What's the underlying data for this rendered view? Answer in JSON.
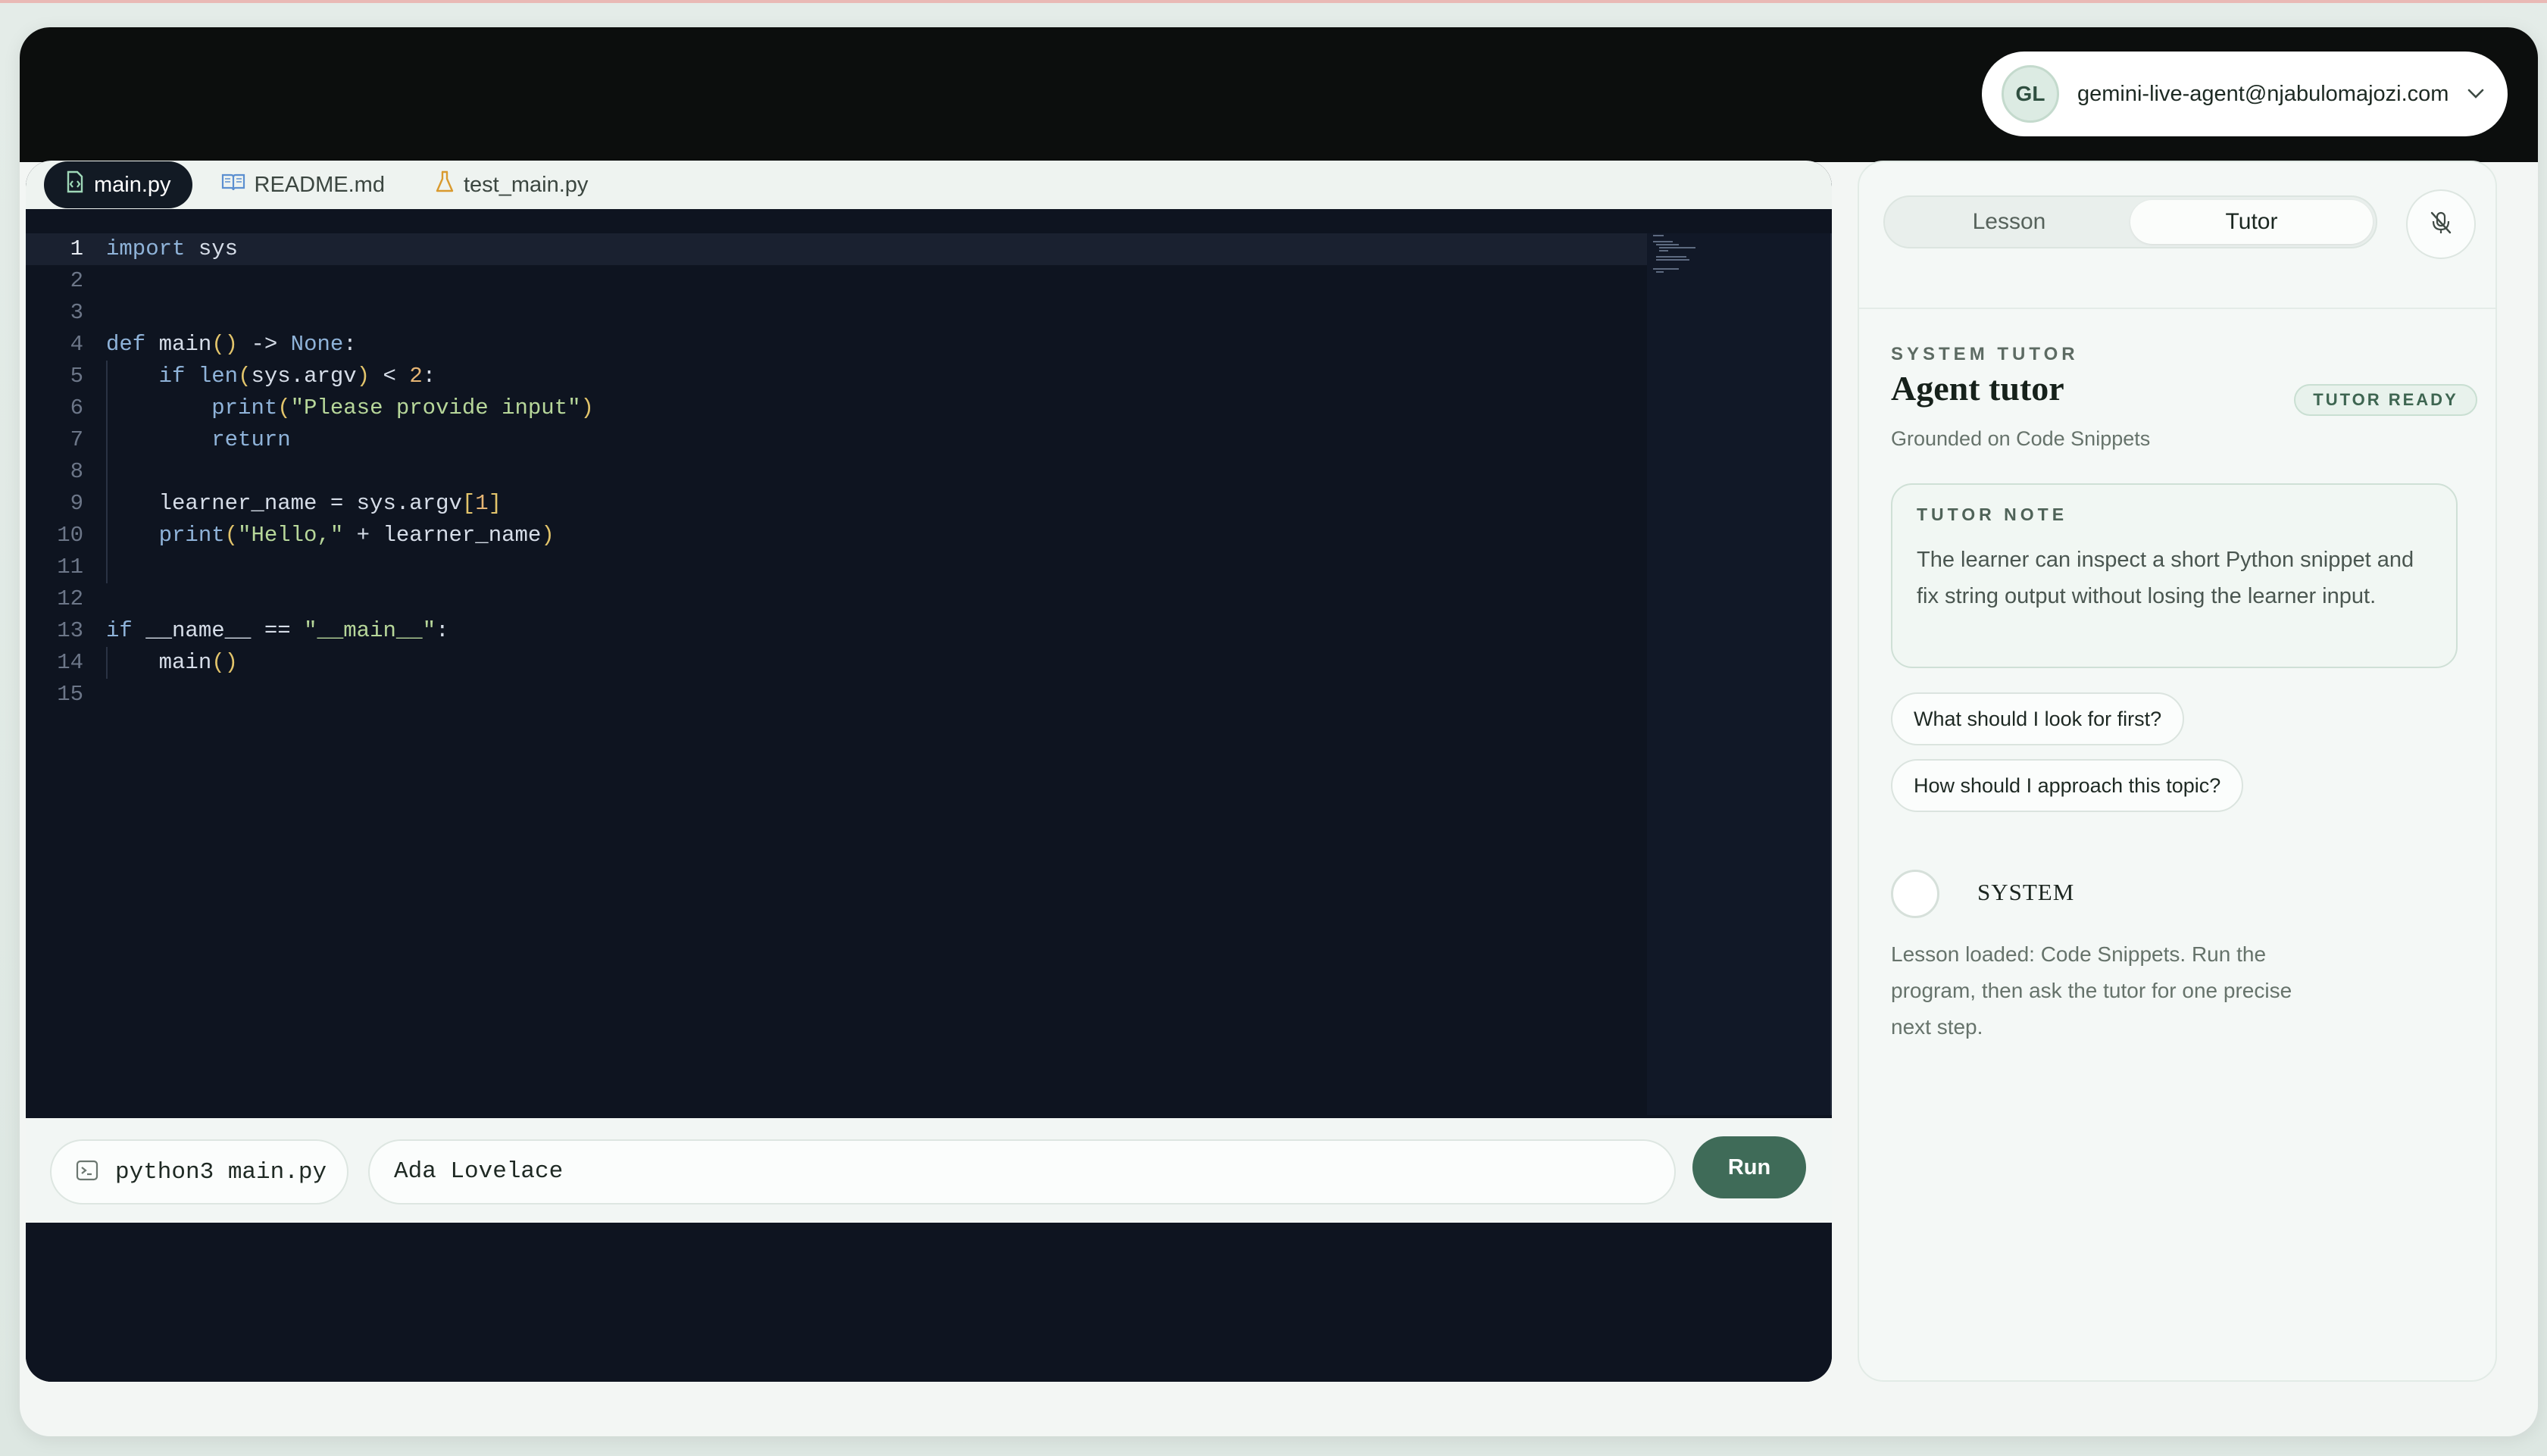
{
  "account": {
    "initials": "GL",
    "email": "gemini-live-agent@njabulomajozi.com"
  },
  "tabs": [
    {
      "label": "main.py",
      "icon": "python-file-icon",
      "active": true
    },
    {
      "label": "README.md",
      "icon": "book-icon",
      "active": false
    },
    {
      "label": "test_main.py",
      "icon": "flask-icon",
      "active": false
    }
  ],
  "editor": {
    "lines": [
      "import sys",
      "",
      "",
      "def main() -> None:",
      "    if len(sys.argv) < 2:",
      "        print(\"Please provide input\")",
      "        return",
      "",
      "    learner_name = sys.argv[1]",
      "    print(\"Hello,\" + learner_name)",
      "",
      "",
      "if __name__ == \"__main__\":",
      "    main()",
      ""
    ],
    "current_line": 1
  },
  "run_bar": {
    "command": "python3 main.py",
    "input_value": "Ada Lovelace",
    "run_label": "Run"
  },
  "tutor": {
    "segments": [
      "Lesson",
      "Tutor"
    ],
    "active_segment": "Tutor",
    "eyebrow": "SYSTEM TUTOR",
    "title": "Agent tutor",
    "status_badge": "TUTOR READY",
    "grounded": "Grounded on Code Snippets",
    "note_label": "TUTOR NOTE",
    "note_text": "The learner can inspect a short Python snippet and fix string output without losing the learner input.",
    "suggestions": [
      "What should I look for first?",
      "How should I approach this topic?"
    ],
    "system_label": "SYSTEM",
    "system_message": "Lesson loaded: Code Snippets. Run the program, then ask the tutor for one precise next step."
  },
  "colors": {
    "header_bg": "#0c0e0d",
    "editor_bg": "#0e1420",
    "accent": "#3f6b58",
    "keyword": "#8fb3d9",
    "string": "#b7d79a",
    "number": "#e6b574"
  }
}
